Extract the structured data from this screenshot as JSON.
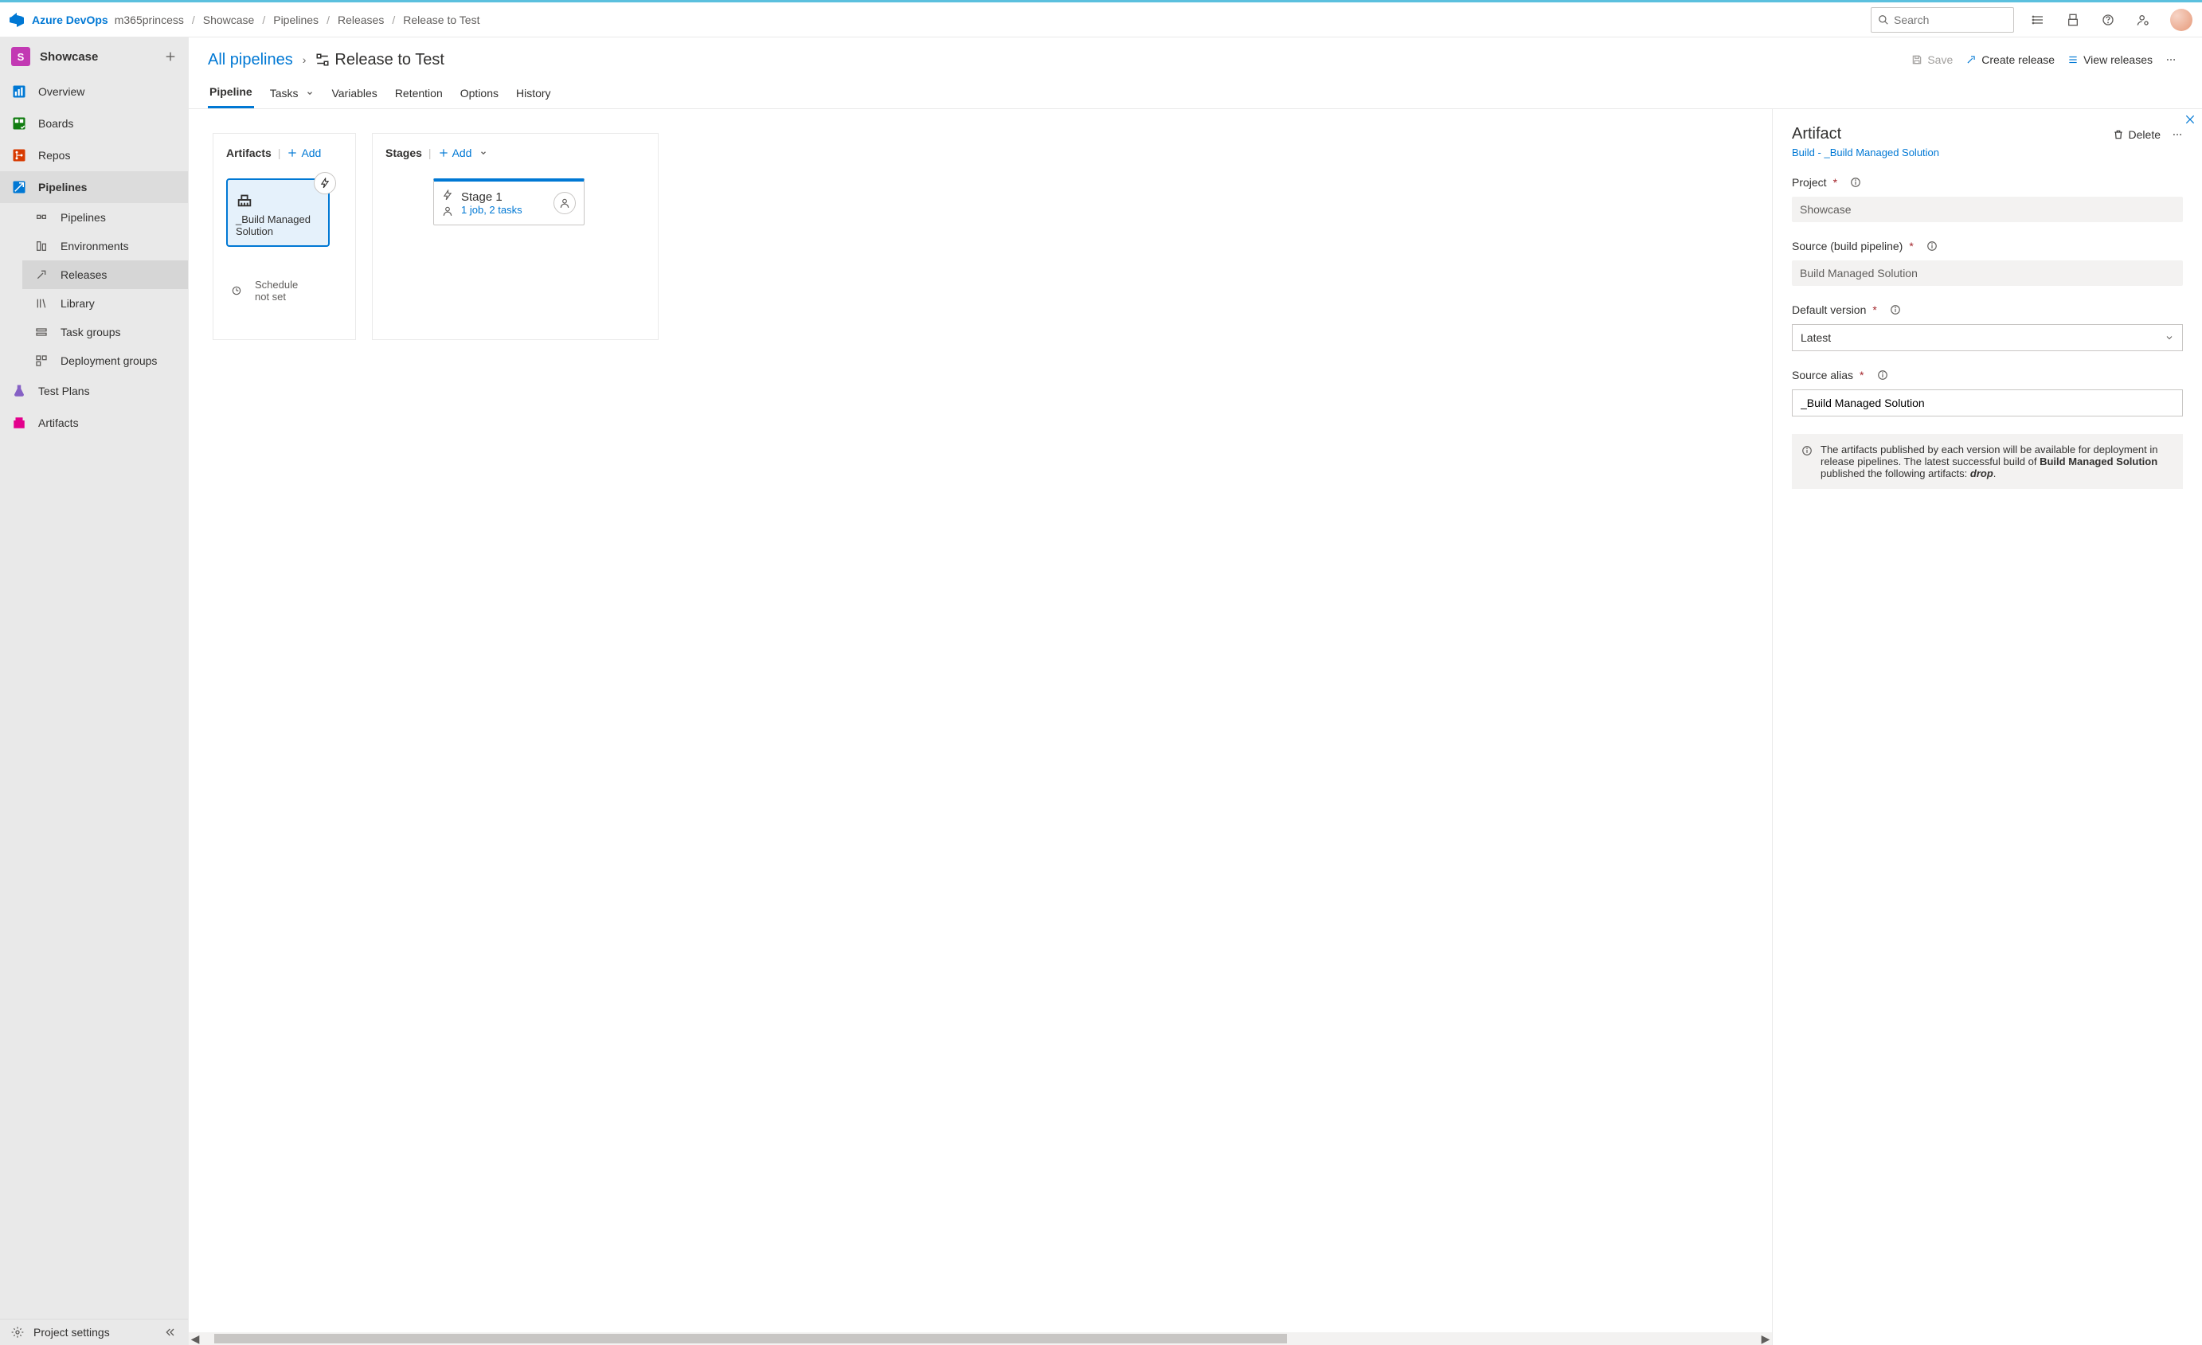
{
  "header": {
    "brand": "Azure DevOps",
    "breadcrumbs": [
      "m365princess",
      "Showcase",
      "Pipelines",
      "Releases",
      "Release to Test"
    ],
    "search_placeholder": "Search"
  },
  "sidebar": {
    "project_initial": "S",
    "project_name": "Showcase",
    "items": [
      {
        "label": "Overview",
        "icon": "overview"
      },
      {
        "label": "Boards",
        "icon": "boards"
      },
      {
        "label": "Repos",
        "icon": "repos"
      },
      {
        "label": "Pipelines",
        "icon": "pipelines",
        "selected": true
      },
      {
        "label": "Test Plans",
        "icon": "testplans"
      },
      {
        "label": "Artifacts",
        "icon": "artifacts"
      }
    ],
    "sub_items": [
      {
        "label": "Pipelines"
      },
      {
        "label": "Environments"
      },
      {
        "label": "Releases",
        "active": true
      },
      {
        "label": "Library"
      },
      {
        "label": "Task groups"
      },
      {
        "label": "Deployment groups"
      }
    ],
    "footer_label": "Project settings"
  },
  "toolbar": {
    "crumb": "All pipelines",
    "title": "Release to Test",
    "save_label": "Save",
    "create_label": "Create release",
    "view_label": "View releases"
  },
  "tabs": [
    "Pipeline",
    "Tasks",
    "Variables",
    "Retention",
    "Options",
    "History"
  ],
  "canvas": {
    "artifacts_title": "Artifacts",
    "stages_title": "Stages",
    "add_label": "Add",
    "artifact_name": "_Build Managed Solution",
    "schedule_l1": "Schedule",
    "schedule_l2": "not set",
    "stage_name": "Stage 1",
    "stage_sub": "1 job, 2 tasks"
  },
  "panel": {
    "title": "Artifact",
    "delete_label": "Delete",
    "subtitle": "Build - _Build Managed Solution",
    "project_label": "Project",
    "project_value": "Showcase",
    "source_label": "Source (build pipeline)",
    "source_value": "Build Managed Solution",
    "version_label": "Default version",
    "version_value": "Latest",
    "alias_label": "Source alias",
    "alias_value": "_Build Managed Solution",
    "info_pre": "The artifacts published by each version will be available for deployment in release pipelines. The latest successful build of ",
    "info_bold": "Build Managed Solution",
    "info_mid": " published the following artifacts: ",
    "info_em": "drop",
    "info_post": "."
  }
}
